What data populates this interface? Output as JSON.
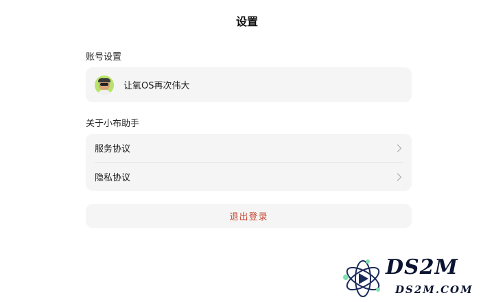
{
  "header": {
    "title": "设置"
  },
  "account_section": {
    "label": "账号设置",
    "user": {
      "name": "让氧OS再次伟大",
      "avatar_icon": "avatar-icon"
    }
  },
  "about_section": {
    "label": "关于小布助手",
    "items": [
      {
        "label": "服务协议",
        "icon": "chevron-right-icon"
      },
      {
        "label": "隐私协议",
        "icon": "chevron-right-icon"
      }
    ]
  },
  "logout": {
    "label": "退出登录",
    "color": "#c4452f"
  },
  "watermark": {
    "text": "DS2M",
    "subtext": "DS2M.COM"
  },
  "colors": {
    "card_bg": "#f5f5f5",
    "page_bg": "#ffffff",
    "accent_red": "#c4452f"
  }
}
